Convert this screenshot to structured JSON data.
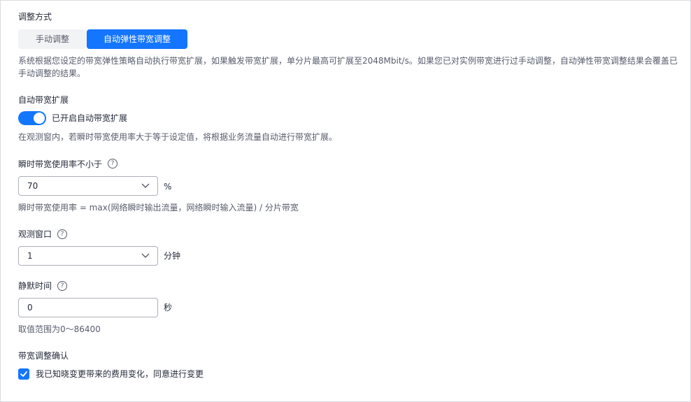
{
  "adjust_mode": {
    "label": "调整方式",
    "manual_label": "手动调整",
    "auto_label": "自动弹性带宽调整",
    "description": "系统根据您设定的带宽弹性策略自动执行带宽扩展，如果触发带宽扩展，单分片最高可扩展至2048Mbit/s。如果您已对实例带宽进行过手动调整，自动弹性带宽调整结果会覆盖已手动调整的结果。"
  },
  "auto_expand": {
    "label": "自动带宽扩展",
    "toggle_on": true,
    "toggle_label": "已开启自动带宽扩展",
    "description": "在观测窗内，若瞬时带宽使用率大于等于设定值，将根据业务流量自动进行带宽扩展。"
  },
  "usage_threshold": {
    "label": "瞬时带宽使用率不小于",
    "help_icon": "question-circle-icon",
    "value": "70",
    "unit": "%",
    "formula": "瞬时带宽使用率 = max(网络瞬时输出流量，网络瞬时输入流量) / 分片带宽"
  },
  "observe_window": {
    "label": "观测窗口",
    "help_icon": "question-circle-icon",
    "value": "1",
    "unit": "分钟"
  },
  "silent_time": {
    "label": "静默时间",
    "help_icon": "question-circle-icon",
    "value": "0",
    "unit": "秒",
    "range_hint": "取值范围为0～86400"
  },
  "confirm": {
    "label": "带宽调整确认",
    "checked": true,
    "checkbox_label": "我已知晓变更带来的费用变化，同意进行变更"
  },
  "colors": {
    "accent": "#1476ff",
    "text": "#252b3a",
    "secondary_text": "#575d6c",
    "border": "#adb0b8"
  }
}
